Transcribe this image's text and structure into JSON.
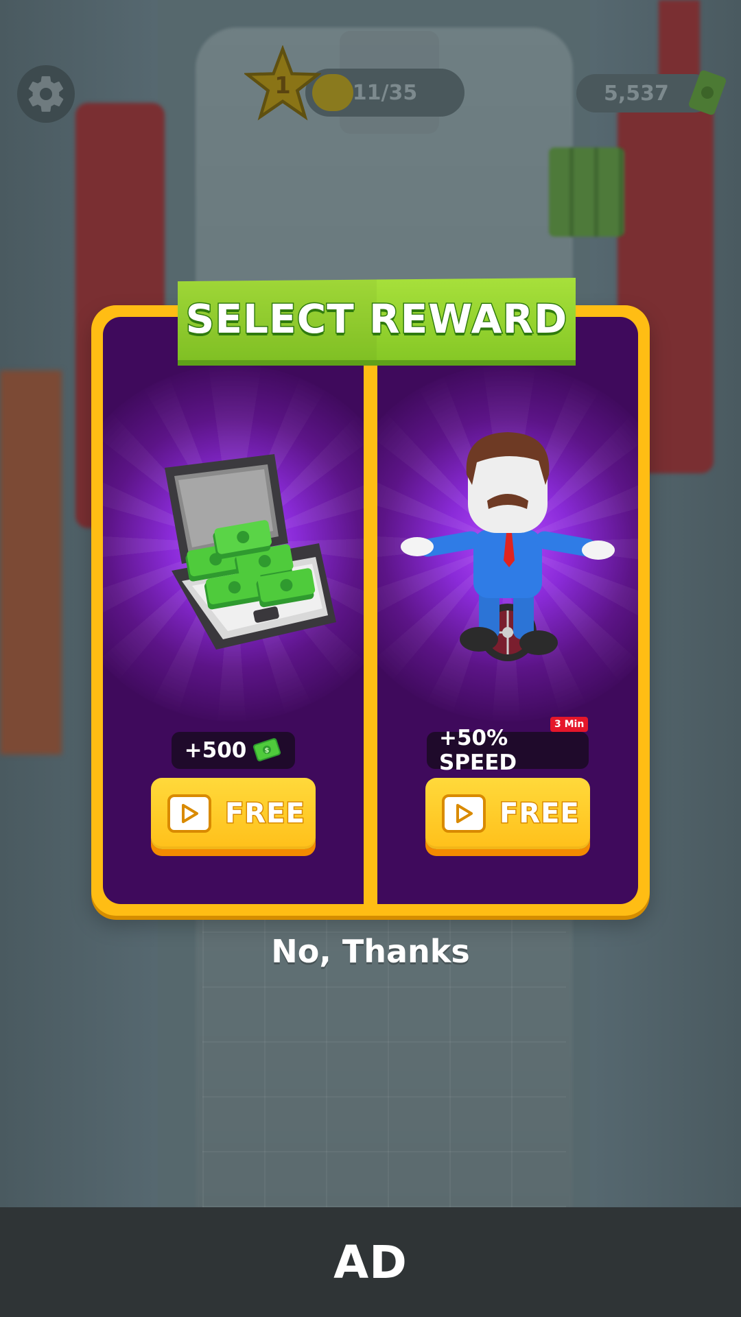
{
  "hud": {
    "level": "1",
    "progress_text": "11/35",
    "cash_text": "5,537"
  },
  "popup": {
    "title": "SELECT REWARD",
    "options": [
      {
        "reward_text": "+500",
        "reward_icon": "cash-icon",
        "button_label": "FREE",
        "button_icon": "play-icon",
        "art": "briefcase-of-cash"
      },
      {
        "reward_text": "+50% SPEED",
        "timer_badge": "3 Min",
        "button_label": "FREE",
        "button_icon": "play-icon",
        "art": "unicycle-character"
      }
    ],
    "dismiss_label": "No, Thanks"
  },
  "ad_bar": {
    "label": "AD"
  },
  "colors": {
    "popup_border": "#ffbd14",
    "panel_bg": "#3f0a5c",
    "banner_green": "#8bd12a",
    "button_yellow": "#ffc825",
    "ad_bar_bg": "#2f3436"
  }
}
